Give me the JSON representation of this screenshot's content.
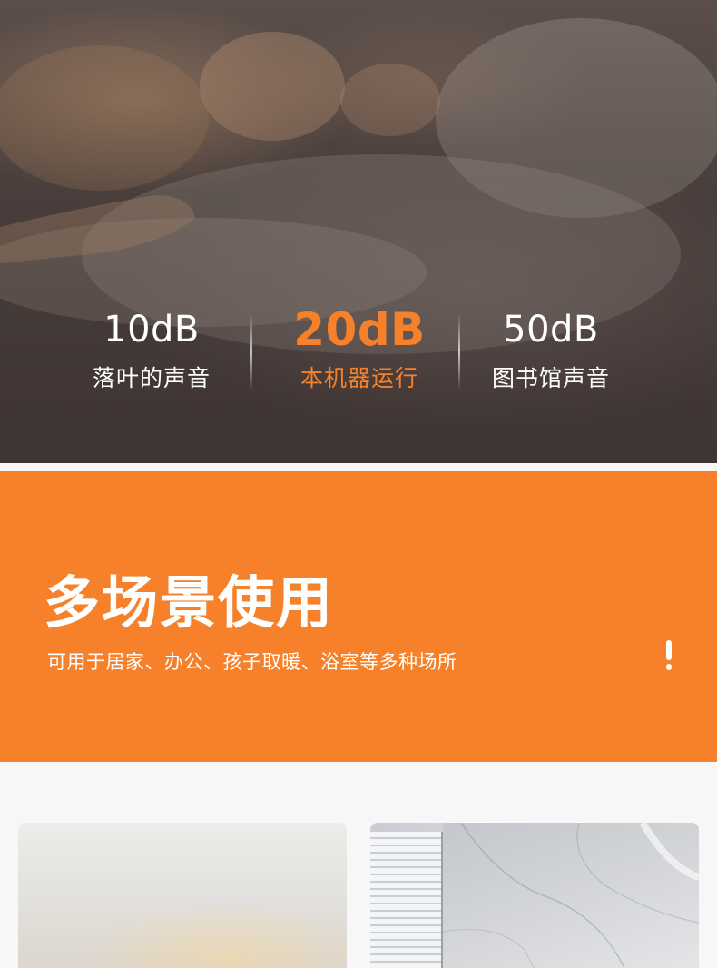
{
  "noise_levels": [
    {
      "value": "10dB",
      "label": "落叶的声音",
      "highlight": false
    },
    {
      "value": "20dB",
      "label": "本机器运行",
      "highlight": true
    },
    {
      "value": "50dB",
      "label": "图书馆声音",
      "highlight": false
    }
  ],
  "banner": {
    "title": "多场景使用",
    "subtitle": "可用于居家、办公、孩子取暖、浴室等多种场所",
    "icon": "exclamation-icon"
  },
  "scenes": [
    {
      "icon": "living-room-photo"
    },
    {
      "icon": "bathroom-photo"
    }
  ],
  "colors": {
    "accent": "#f6812a",
    "hero_bg": "#4f4441",
    "text_light": "#ffffff",
    "page_bg": "#f7f7f7"
  }
}
